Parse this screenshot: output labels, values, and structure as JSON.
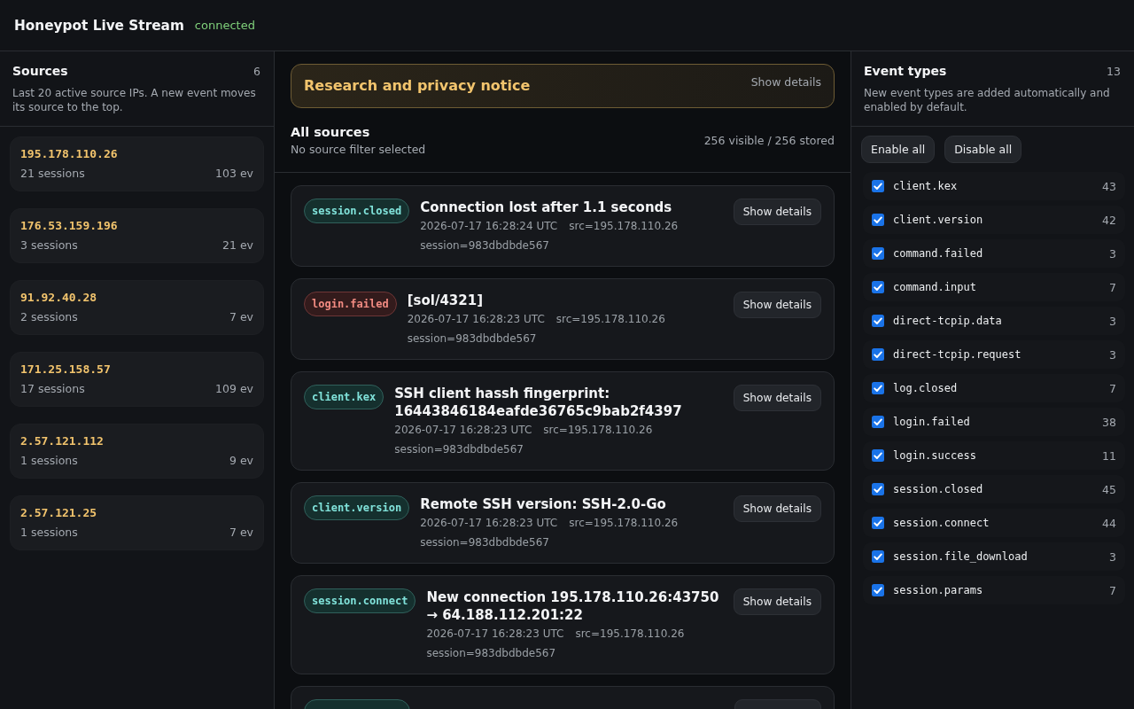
{
  "header": {
    "title": "Honeypot Live Stream",
    "status": {
      "label": "connected",
      "kind": "ok"
    }
  },
  "sources": {
    "title": "Sources",
    "count": "6",
    "description": "Last 20 active source IPs. A new event moves its source to the top.",
    "items": [
      {
        "ip": "195.178.110.26",
        "sessions": "21 sessions",
        "events": "103 ev",
        "selected": false
      },
      {
        "ip": "176.53.159.196",
        "sessions": "3 sessions",
        "events": "21 ev",
        "selected": false
      },
      {
        "ip": "91.92.40.28",
        "sessions": "2 sessions",
        "events": "7 ev",
        "selected": false
      },
      {
        "ip": "171.25.158.57",
        "sessions": "17 sessions",
        "events": "109 ev",
        "selected": false
      },
      {
        "ip": "2.57.121.112",
        "sessions": "1 sessions",
        "events": "9 ev",
        "selected": false
      },
      {
        "ip": "2.57.121.25",
        "sessions": "1 sessions",
        "events": "7 ev",
        "selected": false
      }
    ]
  },
  "notice": {
    "title": "Research and privacy notice",
    "toggle": "Show details"
  },
  "feed": {
    "title": "All sources",
    "subtitle": "No source filter selected",
    "counter": "256 visible / 256 stored",
    "events": [
      {
        "type": "session.closed",
        "kind": "info",
        "title": "Connection lost after 1.1 seconds",
        "time": "2026-07-17 16:28:24 UTC",
        "src": "src=195.178.110.26",
        "session": "session=983dbdbde567",
        "button": "Show details"
      },
      {
        "type": "login.failed",
        "kind": "error",
        "title": "[sol/4321]",
        "time": "2026-07-17 16:28:23 UTC",
        "src": "src=195.178.110.26",
        "session": "session=983dbdbde567",
        "button": "Show details"
      },
      {
        "type": "client.kex",
        "kind": "info",
        "title": "SSH client hassh fingerprint: 16443846184eafde36765c9bab2f4397",
        "time": "2026-07-17 16:28:23 UTC",
        "src": "src=195.178.110.26",
        "session": "session=983dbdbde567",
        "button": "Show details"
      },
      {
        "type": "client.version",
        "kind": "info",
        "title": "Remote SSH version: SSH-2.0-Go",
        "time": "2026-07-17 16:28:23 UTC",
        "src": "src=195.178.110.26",
        "session": "session=983dbdbde567",
        "button": "Show details"
      },
      {
        "type": "session.connect",
        "kind": "info",
        "title": "New connection 195.178.110.26:43750 → 64.188.112.201:22",
        "time": "2026-07-17 16:28:23 UTC",
        "src": "src=195.178.110.26",
        "session": "session=983dbdbde567",
        "button": "Show details"
      },
      {
        "kind": "info"
      }
    ]
  },
  "event_types": {
    "title": "Event types",
    "count": "13",
    "description": "New event types are added automatically and enabled by default.",
    "buttons": [
      "Enable all",
      "Disable all"
    ],
    "items": [
      {
        "name": "client.kex",
        "count": "43",
        "checked": true
      },
      {
        "name": "client.version",
        "count": "42",
        "checked": true
      },
      {
        "name": "command.failed",
        "count": "3",
        "checked": true
      },
      {
        "name": "command.input",
        "count": "7",
        "checked": true
      },
      {
        "name": "direct-tcpip.data",
        "count": "3",
        "checked": true
      },
      {
        "name": "direct-tcpip.request",
        "count": "3",
        "checked": true
      },
      {
        "name": "log.closed",
        "count": "7",
        "checked": true
      },
      {
        "name": "login.failed",
        "count": "38",
        "checked": true
      },
      {
        "name": "login.success",
        "count": "11",
        "checked": true
      },
      {
        "name": "session.closed",
        "count": "45",
        "checked": true
      },
      {
        "name": "session.connect",
        "count": "44",
        "checked": true
      },
      {
        "name": "session.file_download",
        "count": "3",
        "checked": true
      },
      {
        "name": "session.params",
        "count": "7",
        "checked": true
      }
    ]
  }
}
